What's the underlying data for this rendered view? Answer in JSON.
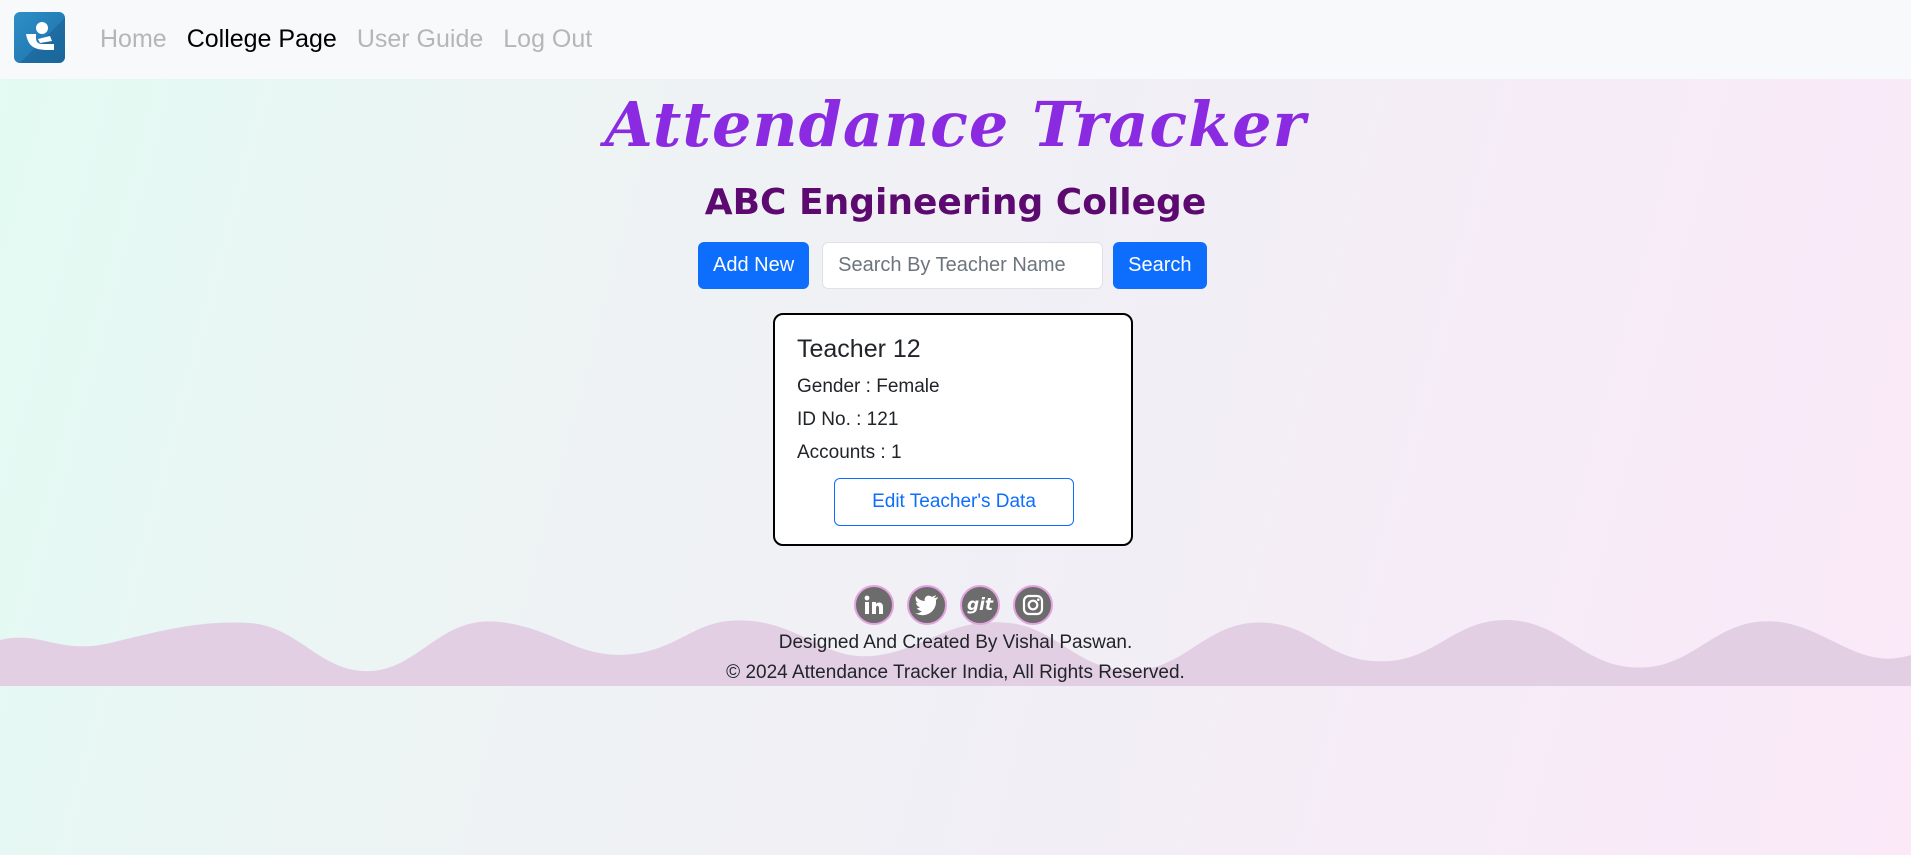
{
  "nav": {
    "brand_icon": "attendance-app-logo",
    "links": [
      "Home",
      "College Page",
      "User Guide",
      "Log Out"
    ]
  },
  "header": {
    "title": "Attendance Tracker",
    "college_name": "ABC Engineering College"
  },
  "toolbar": {
    "add_label": "Add New",
    "search_placeholder": "Search By Teacher Name",
    "search_value": "",
    "search_label": "Search"
  },
  "teachers": [
    {
      "name": "Teacher 12",
      "gender": "Gender : Female",
      "id_no": "ID No.  : 121",
      "accounts": "Accounts  : 1",
      "edit_label": "Edit Teacher's Data"
    }
  ],
  "footer": {
    "socials": [
      "linkedin-icon",
      "twitter-icon",
      "git-icon",
      "instagram-icon"
    ],
    "git_label": "git",
    "credit": "Designed And Created By Vishal Paswan.",
    "copyright": "© 2024 Attendance Tracker India, All Rights Reserved."
  },
  "colors": {
    "title": "#8a2be2",
    "college": "#5c0a70",
    "primary": "#0d6efd",
    "wave": "#e3cfe4"
  }
}
